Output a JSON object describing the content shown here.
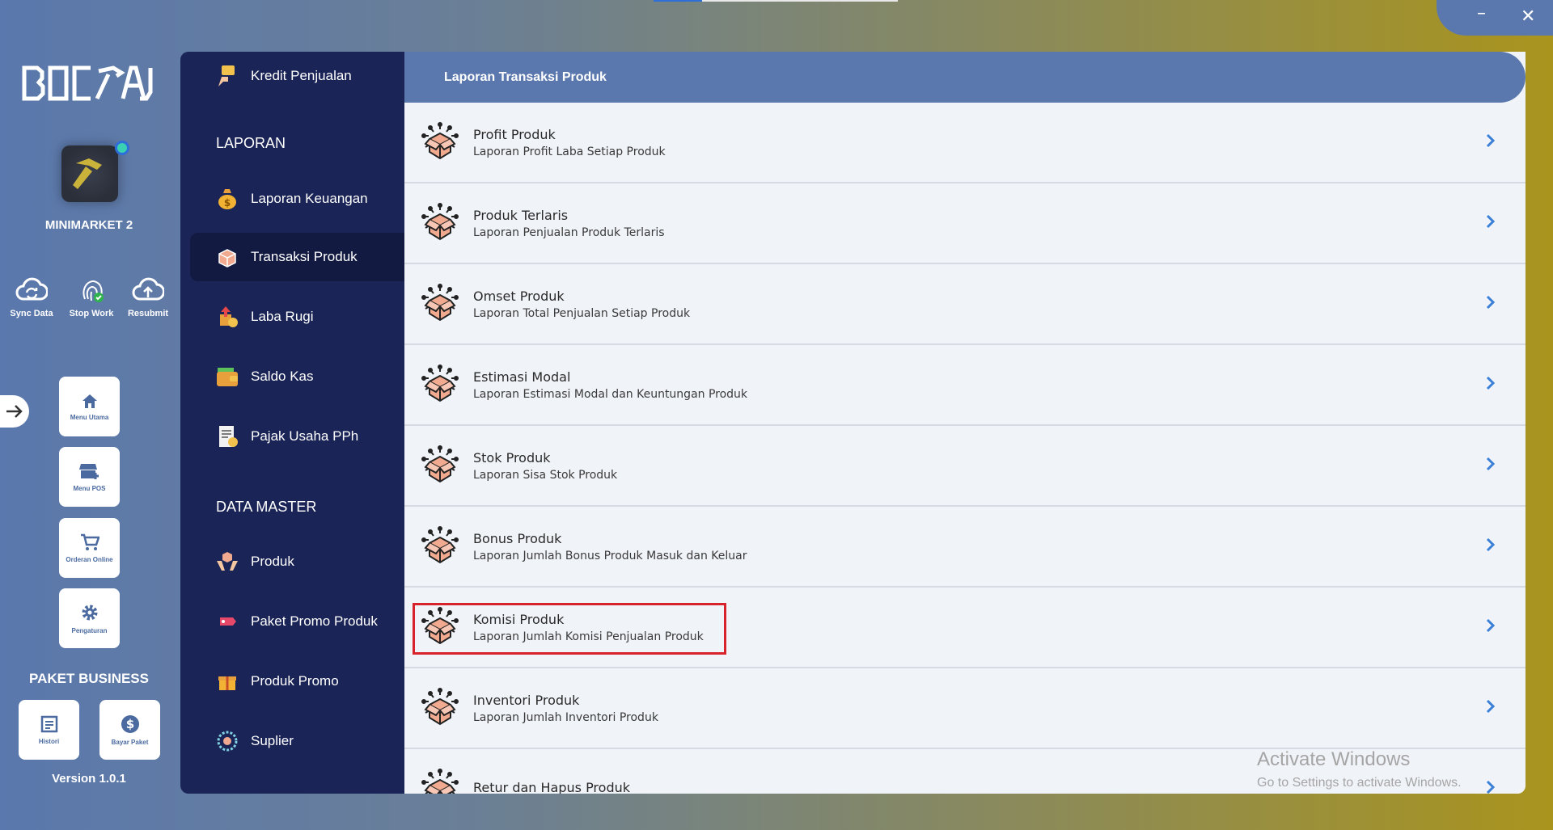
{
  "window": {
    "minimize_icon": "minimize-icon",
    "close_icon": "close-icon",
    "min_label": "–",
    "close_label": "✕"
  },
  "sidebar": {
    "store_name": "MINIMARKET 2",
    "quick_actions": [
      {
        "label": "Sync Data",
        "icon": "cloud-sync-icon"
      },
      {
        "label": "Stop Work",
        "icon": "fingerprint-icon"
      },
      {
        "label": "Resubmit",
        "icon": "cloud-upload-icon"
      }
    ],
    "cards": [
      {
        "label": "Menu Utama",
        "icon": "home-icon"
      },
      {
        "label": "Menu POS",
        "icon": "store-icon"
      },
      {
        "label": "Orderan Online",
        "icon": "cart-icon"
      },
      {
        "label": "Pengaturan",
        "icon": "gear-icon"
      }
    ],
    "package_title": "PAKET BUSINESS",
    "package_cards": [
      {
        "label": "Histori",
        "icon": "history-icon"
      },
      {
        "label": "Bayar Paket",
        "icon": "dollar-icon"
      }
    ],
    "version": "Version 1.0.1"
  },
  "nav": {
    "top_item": "Kredit Penjualan",
    "section_laporan": "LAPORAN",
    "laporan_items": [
      "Laporan Keuangan",
      "Transaksi Produk",
      "Laba Rugi",
      "Saldo Kas",
      "Pajak Usaha PPh"
    ],
    "section_master": "DATA MASTER",
    "master_items": [
      "Produk",
      "Paket Promo Produk",
      "Produk Promo",
      "Suplier"
    ]
  },
  "content": {
    "header": "Laporan Transaksi Produk",
    "rows": [
      {
        "title": "Profit Produk",
        "sub": "Laporan Profit Laba Setiap Produk"
      },
      {
        "title": "Produk Terlaris",
        "sub": "Laporan Penjualan Produk Terlaris"
      },
      {
        "title": "Omset Produk",
        "sub": "Laporan Total Penjualan Setiap Produk"
      },
      {
        "title": "Estimasi Modal",
        "sub": "Laporan Estimasi Modal dan Keuntungan Produk"
      },
      {
        "title": "Stok Produk",
        "sub": "Laporan Sisa Stok Produk"
      },
      {
        "title": "Bonus Produk",
        "sub": "Laporan Jumlah Bonus Produk Masuk dan Keluar"
      },
      {
        "title": "Komisi Produk",
        "sub": "Laporan Jumlah Komisi Penjualan Produk"
      },
      {
        "title": "Inventori Produk",
        "sub": "Laporan Jumlah Inventori Produk"
      },
      {
        "title": "Retur dan Hapus Produk",
        "sub": ""
      }
    ]
  },
  "watermark": {
    "line1": "Activate Windows",
    "line2": "Go to Settings to activate Windows."
  },
  "colors": {
    "accent": "#5b78ae",
    "nav_bg": "#1a2456",
    "highlight": "#d8222c",
    "chevron": "#3b7fd6"
  }
}
